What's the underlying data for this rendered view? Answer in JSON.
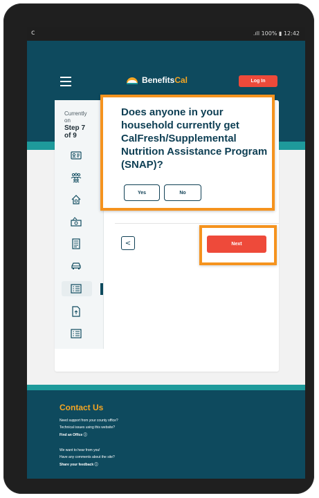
{
  "status_bar": {
    "left_icon": "c",
    "right_text": ".ıll 100% ▮ 12:42"
  },
  "header": {
    "logo": {
      "benefits": "Benefits",
      "cal": "Cal"
    },
    "login_label": "Log In"
  },
  "progress": {
    "currently": "Currently",
    "on": "on",
    "step": "Step 7",
    "of": "of 9"
  },
  "sidebar_icons": [
    "id-card-icon",
    "people-icon",
    "house-icon",
    "money-icon",
    "document-icon",
    "car-icon",
    "list-icon",
    "upload-file-icon",
    "checklist-icon"
  ],
  "question": {
    "text": "Does anyone in your household currently get CalFresh/Supplemental Nutrition Assistance Program (SNAP)?",
    "yes_label": "Yes",
    "no_label": "No"
  },
  "nav": {
    "back_symbol": "<",
    "next_label": "Next"
  },
  "footer": {
    "title": "Contact Us",
    "line1": "Need support from your county office?",
    "line2": "Technical issues using this website?",
    "link1": "Find an Office",
    "line3": "We want to hear from you!",
    "line4": "Have any comments about the site?",
    "link2": "Share your feedback"
  },
  "colors": {
    "header_bg": "#0e4a5e",
    "accent_teal": "#1e9a9b",
    "brand_orange": "#f5a623",
    "button_red": "#ee4a3a",
    "highlight_orange": "#f5931e"
  }
}
